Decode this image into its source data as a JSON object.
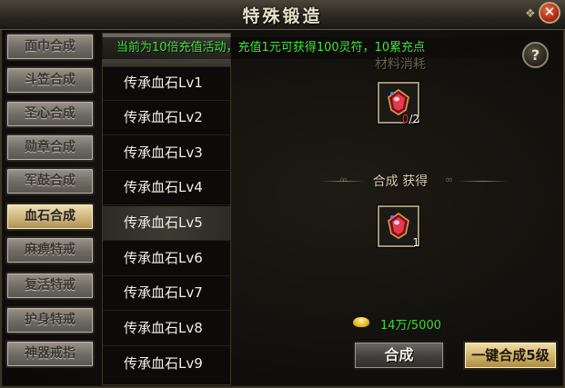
{
  "window": {
    "title": "特殊锻造",
    "close_label": "✕",
    "help_label": "?"
  },
  "banner": {
    "text": "当前为10倍充值活动，充值1元可获得100灵符，10累充点"
  },
  "tabs": [
    {
      "label": "面巾合成",
      "active": false
    },
    {
      "label": "斗笠合成",
      "active": false
    },
    {
      "label": "圣心合成",
      "active": false
    },
    {
      "label": "勋章合成",
      "active": false
    },
    {
      "label": "军鼓合成",
      "active": false
    },
    {
      "label": "血石合成",
      "active": true
    },
    {
      "label": "麻痹特戒",
      "active": false
    },
    {
      "label": "复活特戒",
      "active": false
    },
    {
      "label": "护身特戒",
      "active": false
    },
    {
      "label": "神器戒指",
      "active": false
    }
  ],
  "items": [
    {
      "label": "传承血石Lv1",
      "selected": false
    },
    {
      "label": "传承血石Lv2",
      "selected": false
    },
    {
      "label": "传承血石Lv3",
      "selected": false
    },
    {
      "label": "传承血石Lv4",
      "selected": false
    },
    {
      "label": "传承血石Lv5",
      "selected": true
    },
    {
      "label": "传承血石Lv6",
      "selected": false
    },
    {
      "label": "传承血石Lv7",
      "selected": false
    },
    {
      "label": "传承血石Lv8",
      "selected": false
    },
    {
      "label": "传承血石Lv9",
      "selected": false
    }
  ],
  "material": {
    "section_label": "材料消耗",
    "have": "0",
    "need": "/2",
    "icon": "blood-stone-icon"
  },
  "result": {
    "section_label": "合成 获得",
    "count": "1",
    "icon": "blood-stone-icon"
  },
  "cost": {
    "icon": "gold-ingot-icon",
    "text": "14万/5000"
  },
  "buttons": {
    "compose": "合成",
    "one_key": "一键合成5级"
  },
  "colors": {
    "banner_text": "#42e83a",
    "active_tab": "#cdb47b",
    "material_shortage": "#ff2d1e"
  }
}
